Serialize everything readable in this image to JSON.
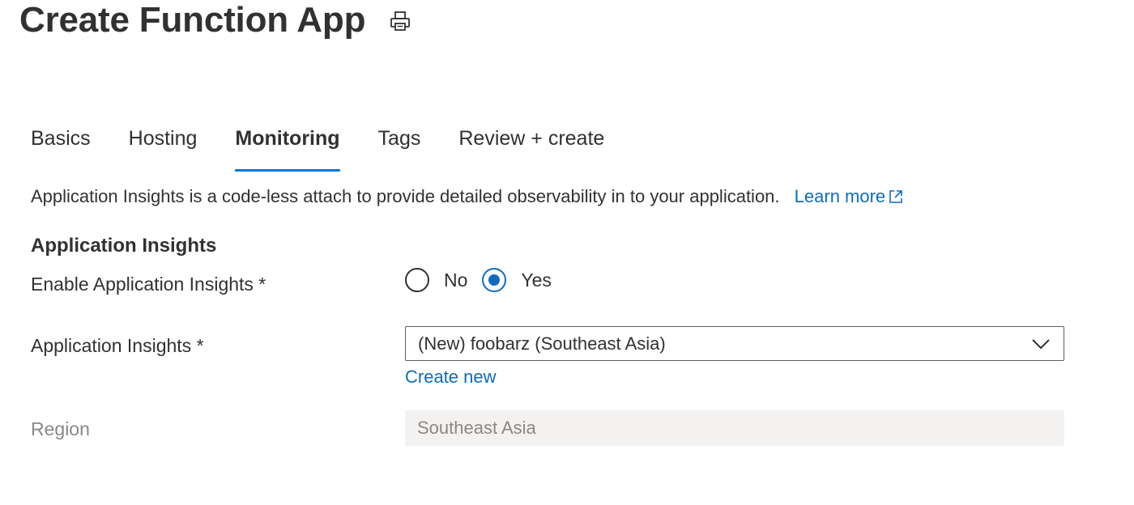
{
  "header": {
    "title": "Create Function App",
    "print_icon": "print-icon"
  },
  "tabs": [
    {
      "label": "Basics",
      "active": false
    },
    {
      "label": "Hosting",
      "active": false
    },
    {
      "label": "Monitoring",
      "active": true
    },
    {
      "label": "Tags",
      "active": false
    },
    {
      "label": "Review + create",
      "active": false
    }
  ],
  "description": {
    "text": "Application Insights is a code-less attach to provide detailed observability in to your application.",
    "link_label": "Learn more",
    "link_icon": "external-link-icon"
  },
  "section": {
    "title": "Application Insights"
  },
  "fields": {
    "enable": {
      "label": "Enable Application Insights *",
      "options": [
        "No",
        "Yes"
      ],
      "selected": "Yes"
    },
    "insights": {
      "label": "Application Insights *",
      "value": "(New) foobarz (Southeast Asia)",
      "create_new_label": "Create new"
    },
    "region": {
      "label": "Region",
      "value": "Southeast Asia",
      "disabled": true
    }
  },
  "colors": {
    "accent": "#0078d4",
    "link": "#0f6cbd",
    "text": "#323130",
    "disabled_text": "#8a8886",
    "disabled_bg": "#f3f2f1"
  }
}
